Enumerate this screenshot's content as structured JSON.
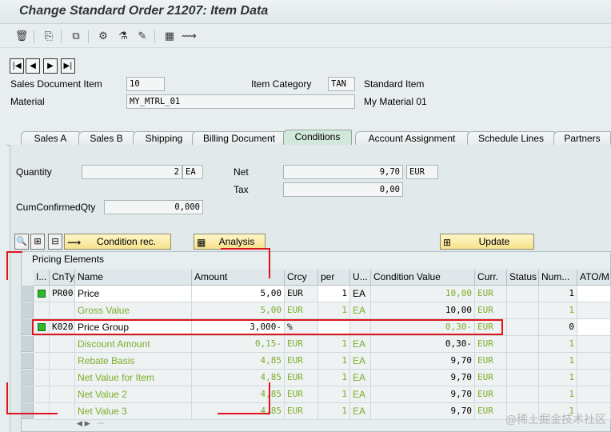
{
  "window": {
    "title": "Change Standard Order 21207: Item Data"
  },
  "toolbar": {
    "icons": [
      "trash-icon",
      "copy-doc-icon",
      "display-doc-icon",
      "org-structure-icon",
      "flask-icon",
      "edit-icon",
      "calculator-icon",
      "handshake-icon"
    ],
    "glyphs": [
      "🗑",
      "⎘",
      "⧉",
      "⚙",
      "⚗",
      "✎",
      "▦",
      "⟿"
    ]
  },
  "nav": {
    "first": "|◀",
    "prev": "◀",
    "next": "▶",
    "last": "▶|"
  },
  "header": {
    "sales_doc_item_label": "Sales Document Item",
    "sales_doc_item_value": "10",
    "item_category_label": "Item Category",
    "item_category_value": "TAN",
    "item_category_text": "Standard Item",
    "material_label": "Material",
    "material_value": "MY_MTRL_01",
    "material_text": "My Material 01"
  },
  "tabs": [
    {
      "label": "Sales A"
    },
    {
      "label": "Sales B"
    },
    {
      "label": "Shipping"
    },
    {
      "label": "Billing Document"
    },
    {
      "label": "Conditions",
      "active": true
    },
    {
      "label": "Account Assignment"
    },
    {
      "label": "Schedule Lines"
    },
    {
      "label": "Partners"
    }
  ],
  "conditions": {
    "quantity_label": "Quantity",
    "quantity_value": "2",
    "quantity_unit": "EA",
    "net_label": "Net",
    "net_value": "9,70",
    "net_currency": "EUR",
    "tax_label": "Tax",
    "tax_value": "0,00",
    "cum_label": "CumConfirmedQty",
    "cum_value": "0,000",
    "condition_rec_label": "Condition rec.",
    "analysis_label": "Analysis",
    "update_label": "Update"
  },
  "grid": {
    "title": "Pricing Elements",
    "columns": [
      "I...",
      "CnTy",
      "Name",
      "Amount",
      "Crcy",
      "per",
      "U...",
      "Condition Value",
      "Curr.",
      "Status",
      "Num...",
      "ATO/M"
    ],
    "rows": [
      {
        "ind": true,
        "type": "PR00",
        "name": "Price",
        "amount": "5,00",
        "crcy": "EUR",
        "per": "1",
        "uom": "EA",
        "value": "10,00",
        "curr": "EUR",
        "num": "1",
        "green": false,
        "value_green": true,
        "edit": true
      },
      {
        "ind": false,
        "type": "",
        "name": "Gross Value",
        "amount": "5,00",
        "crcy": "EUR",
        "per": "1",
        "uom": "EA",
        "value": "10,00",
        "curr": "EUR",
        "num": "1",
        "green": true,
        "value_green": false,
        "edit": false
      },
      {
        "ind": true,
        "type": "K020",
        "name": "Price Group",
        "amount": "3,000-",
        "crcy": "%",
        "per": "",
        "uom": "",
        "value": "0,30-",
        "curr": "EUR",
        "num": "0",
        "green": false,
        "value_green": true,
        "edit": true
      },
      {
        "ind": false,
        "type": "",
        "name": "Discount Amount",
        "amount": "0,15-",
        "crcy": "EUR",
        "per": "1",
        "uom": "EA",
        "value": "0,30-",
        "curr": "EUR",
        "num": "1",
        "green": true,
        "value_green": false,
        "edit": false
      },
      {
        "ind": false,
        "type": "",
        "name": "Rebate Basis",
        "amount": "4,85",
        "crcy": "EUR",
        "per": "1",
        "uom": "EA",
        "value": "9,70",
        "curr": "EUR",
        "num": "1",
        "green": true,
        "value_green": false,
        "edit": false
      },
      {
        "ind": false,
        "type": "",
        "name": "Net Value for Item",
        "amount": "4,85",
        "crcy": "EUR",
        "per": "1",
        "uom": "EA",
        "value": "9,70",
        "curr": "EUR",
        "num": "1",
        "green": true,
        "value_green": false,
        "edit": false
      },
      {
        "ind": false,
        "type": "",
        "name": "Net Value 2",
        "amount": "4,85",
        "crcy": "EUR",
        "per": "1",
        "uom": "EA",
        "value": "9,70",
        "curr": "EUR",
        "num": "1",
        "green": true,
        "value_green": false,
        "edit": false
      },
      {
        "ind": false,
        "type": "",
        "name": "Net Value 3",
        "amount": "4,85",
        "crcy": "EUR",
        "per": "1",
        "uom": "EA",
        "value": "9,70",
        "curr": "EUR",
        "num": "1",
        "green": true,
        "value_green": false,
        "edit": false
      }
    ]
  },
  "watermark": "@稀土掘金技术社区",
  "colors": {
    "highlight": "#e0141c",
    "green_text": "#7cae2a",
    "indicator": "#2db82d"
  }
}
